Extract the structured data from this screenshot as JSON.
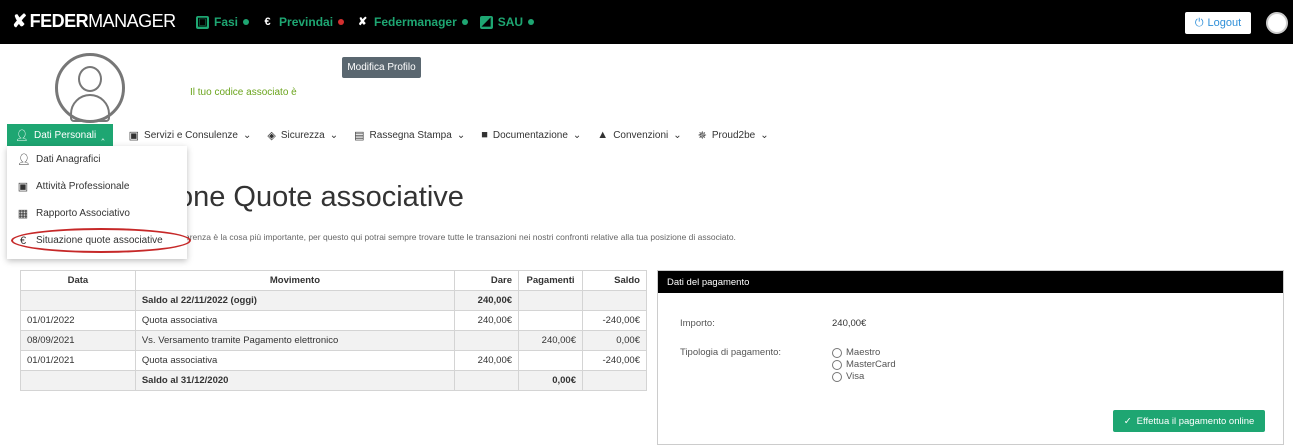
{
  "header": {
    "brand_bold": "FEDER",
    "brand_light": "MANAGER",
    "links": [
      {
        "label": "Fasi",
        "icon": "fasi-icon",
        "dot_color": "#1ea672"
      },
      {
        "label": "Previndai",
        "icon": "euro-circle-icon",
        "dot_color": "#d32f2f"
      },
      {
        "label": "Federmanager",
        "icon": "federmanager-icon",
        "dot_color": "#1ea672"
      },
      {
        "label": "SAU",
        "icon": "sau-icon",
        "dot_color": "#1ea672"
      }
    ],
    "logout_label": "Logout"
  },
  "profile": {
    "codice_label": "Il tuo codice associato è",
    "edit_button": "Modifica Profilo"
  },
  "nav": {
    "items": [
      {
        "label": "Dati Personali"
      },
      {
        "label": "Servizi e Consulenze"
      },
      {
        "label": "Sicurezza"
      },
      {
        "label": "Rassegna Stampa"
      },
      {
        "label": "Documentazione"
      },
      {
        "label": "Convenzioni"
      },
      {
        "label": "Proud2be"
      }
    ]
  },
  "dropdown": {
    "items": [
      {
        "label": "Dati Anagrafici"
      },
      {
        "label": "Attività Professionale"
      },
      {
        "label": "Rapporto Associativo"
      },
      {
        "label": "Situazione quote associative"
      }
    ]
  },
  "page": {
    "title": "zione Quote associative",
    "intro": "arenza è la cosa più importante, per questo qui potrai sempre trovare tutte le transazioni nei nostri confronti relative alla tua posizione di associato."
  },
  "table": {
    "headers": [
      "Data",
      "Movimento",
      "Dare",
      "Pagamenti",
      "Saldo"
    ],
    "rows": [
      [
        "",
        "Saldo al 22/11/2022 (oggi)",
        "240,00€",
        "",
        ""
      ],
      [
        "01/01/2022",
        "Quota associativa",
        "240,00€",
        "",
        "-240,00€"
      ],
      [
        "08/09/2021",
        "Vs. Versamento tramite Pagamento elettronico",
        "",
        "240,00€",
        "0,00€"
      ],
      [
        "01/01/2021",
        "Quota associativa",
        "240,00€",
        "",
        "-240,00€"
      ],
      [
        "",
        "Saldo al 31/12/2020",
        "",
        "0,00€",
        ""
      ]
    ]
  },
  "payment": {
    "title": "Dati del pagamento",
    "importo_label": "Importo:",
    "importo_value": "240,00€",
    "tipologia_label": "Tipologia di pagamento:",
    "options": [
      "Maestro",
      "MasterCard",
      "Visa"
    ],
    "button_label": "Effettua il pagamento online"
  },
  "colors": {
    "accent": "#1ea672",
    "topbar": "#000000",
    "highlight": "#c62828"
  }
}
